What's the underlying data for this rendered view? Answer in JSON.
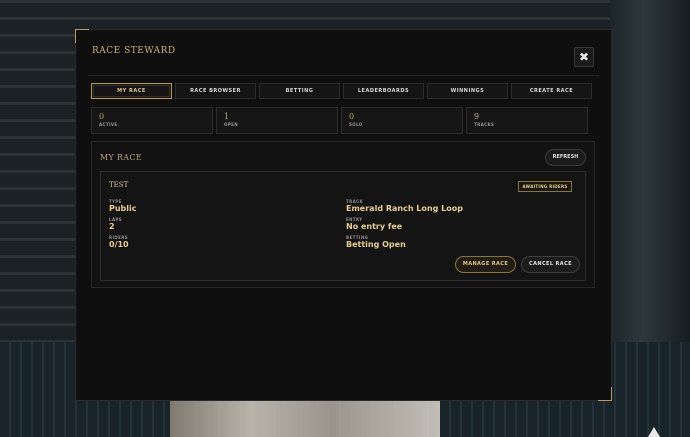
{
  "window": {
    "title": "Race Steward",
    "close_glyph": "✖"
  },
  "tabs": [
    {
      "label": "My Race",
      "active": true
    },
    {
      "label": "Race Browser",
      "active": false
    },
    {
      "label": "Betting",
      "active": false
    },
    {
      "label": "Leaderboards",
      "active": false
    },
    {
      "label": "Winnings",
      "active": false
    },
    {
      "label": "Create Race",
      "active": false
    }
  ],
  "stats": [
    {
      "value": "0",
      "label": "Active"
    },
    {
      "value": "1",
      "label": "Open"
    },
    {
      "value": "0",
      "label": "Solo"
    },
    {
      "value": "9",
      "label": "Tracks"
    }
  ],
  "my_race": {
    "title": "My Race",
    "refresh_label": "Refresh",
    "race": {
      "name": "Test",
      "status": "Awaiting Riders",
      "fields": {
        "type": {
          "label": "Type",
          "value": "Public"
        },
        "laps": {
          "label": "Laps",
          "value": "2"
        },
        "riders": {
          "label": "Riders",
          "value": "0/10"
        },
        "track": {
          "label": "Track",
          "value": "Emerald Ranch Long Loop"
        },
        "entry": {
          "label": "Entry",
          "value": "No entry fee"
        },
        "betting": {
          "label": "Betting",
          "value": "Betting Open"
        }
      },
      "manage_label": "Manage Race",
      "cancel_label": "Cancel Race"
    }
  },
  "colors": {
    "accent": "#b89a5a",
    "value": "#e6cf8e",
    "panel": "#0f0f0f"
  }
}
